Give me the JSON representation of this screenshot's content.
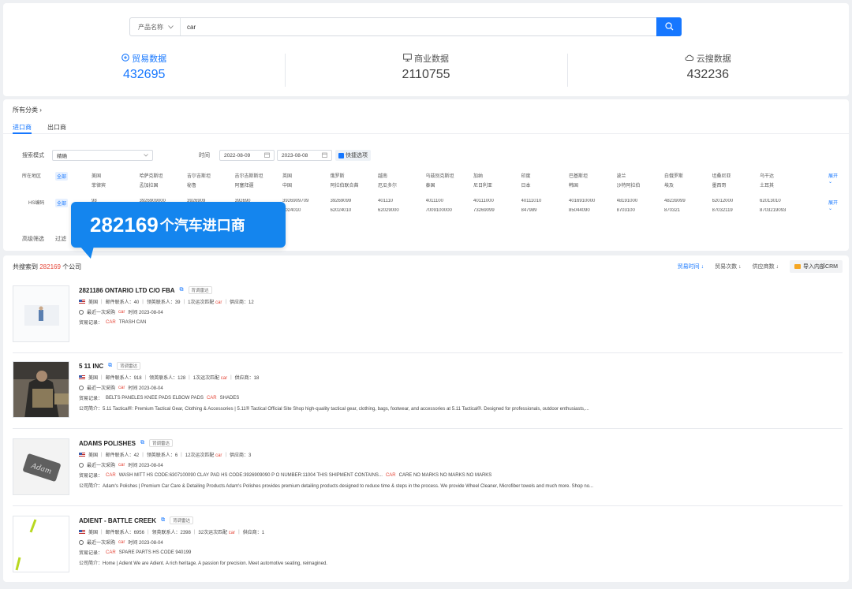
{
  "search": {
    "select_label": "产品名称",
    "value": "car"
  },
  "stats": [
    {
      "label": "贸易数据",
      "value": "432695",
      "icon": "trade-data-icon"
    },
    {
      "label": "商业数据",
      "value": "2110755",
      "icon": "business-data-icon"
    },
    {
      "label": "云搜数据",
      "value": "432236",
      "icon": "cloud-search-icon"
    }
  ],
  "filters": {
    "all_categories": "所有分类",
    "tabs": [
      "进口商",
      "出口商"
    ],
    "mode_label": "搜索模式",
    "mode_value": "精确",
    "time_label": "时间",
    "date_from": "2022-08-09",
    "date_to": "2023-08-08",
    "quick_option": "快捷选项",
    "region_label": "所在地区",
    "all": "全部",
    "expand": "展开",
    "regions_row1": [
      "美国",
      "哈萨克斯坦",
      "吉尔吉斯坦",
      "吉尔吉斯斯坦",
      "英国",
      "俄罗斯",
      "越南",
      "乌兹别克斯坦",
      "加纳",
      "印度",
      "巴基斯坦",
      "波兰",
      "白俄罗斯",
      "坦桑尼亚",
      "乌干达"
    ],
    "regions_row2": [
      "菲律宾",
      "孟加拉国",
      "秘鲁",
      "阿塞拜疆",
      "中国",
      "阿拉伯联合酋",
      "厄瓜多尔",
      "泰国",
      "尼日利亚",
      "日本",
      "韩国",
      "沙特阿拉伯",
      "埃及",
      "墨西哥",
      "土耳其"
    ],
    "hs_label": "HS编码",
    "hs_row1": [
      "98",
      "3926909000",
      "3926909",
      "392690",
      "3926909709",
      "39269099",
      "401110",
      "4011100",
      "40111000",
      "40111010",
      "4016910000",
      "48191000",
      "48239099",
      "62012000",
      "62013010"
    ],
    "hs_row2": [
      "",
      "",
      "",
      "",
      "6024010",
      "62024010",
      "62029000",
      "7009100000",
      "73269099",
      "847989",
      "85044090",
      "8703100",
      "870321",
      "87032119",
      "8703219093"
    ],
    "advanced_label": "高级筛选",
    "advanced_value": "过滤"
  },
  "tooltip": {
    "number": "282169",
    "text": "个汽车进口商"
  },
  "results": {
    "prefix": "共搜索到",
    "count": "282169",
    "suffix": "个公司",
    "sort_trade_time": "贸易时间",
    "sort_trade_count": "贸易次数",
    "sort_supplier_count": "供应商数",
    "crm_button": "导入内部CRM",
    "items": [
      {
        "name": "2821186 ONTARIO LTD C/O FBA",
        "tag": "背调雷达",
        "country": "美国",
        "mail": "邮件联系人：40",
        "linkedin": "领英联系人：39",
        "match": "1次运次匹配",
        "match_kw": "car",
        "supplier": "供应商：12",
        "last_buy_prefix": "最近一次采购",
        "last_buy_kw": "car",
        "last_buy_time": "时间 2023-08-04",
        "record_label": "贸易记录：",
        "record_kw": "CAR",
        "record_text": "TRASH CAN",
        "intro": ""
      },
      {
        "name": "5 11 INC",
        "tag": "背调雷达",
        "country": "美国",
        "mail": "邮件联系人：918",
        "linkedin": "领英联系人：128",
        "match": "1次运次匹配",
        "match_kw": "car",
        "supplier": "供应商：18",
        "last_buy_prefix": "最近一次采购",
        "last_buy_kw": "car",
        "last_buy_time": "时间 2023-08-04",
        "record_label": "贸易记录：",
        "record_kw": "CAR",
        "record_text": "BELTS PANELES KNEE PADS ELBOW PADS",
        "record_after": "SHADES",
        "intro": "公司简介：5.11 Tactical®: Premium Tactical Gear, Clothing & Accessories | 5.11® Tactical Official Site Shop high-quality tactical gear, clothing, bags, footwear, and accessories at 5.11 Tactical®. Designed for professionals, outdoor enthusiasts,..."
      },
      {
        "name": "ADAMS POLISHES",
        "tag": "背调雷达",
        "country": "美国",
        "mail": "邮件联系人：42",
        "linkedin": "领英联系人：6",
        "match": "12次运次匹配",
        "match_kw": "car",
        "supplier": "供应商：3",
        "last_buy_prefix": "最近一次采购",
        "last_buy_kw": "car",
        "last_buy_time": "时间 2023-08-04",
        "record_label": "贸易记录：",
        "record_kw": "CAR",
        "record_text": "WASH MITT HS CODE:6307100090 CLAY PAD HS CODE:3926909090 P O NUMBER:11004 THIS SHIPMENT CONTAINS...",
        "record_kw2": "CAR",
        "record_after": "CARE NO MARKS NO MARKS NO MARKS",
        "intro": "公司简介：Adam's Polishes | Premium Car Care & Detailing Products Adam's Polishes provides premium detailing products designed to reduce time & steps in the process. We provide Wheel Cleaner, Microfiber towels and much more. Shop no..."
      },
      {
        "name": "ADIENT - BATTLE CREEK",
        "tag": "背调雷达",
        "country": "美国",
        "mail": "邮件联系人：6956",
        "linkedin": "领英联系人：2398",
        "match": "32次运次匹配",
        "match_kw": "car",
        "supplier": "供应商：1",
        "last_buy_prefix": "最近一次采购",
        "last_buy_kw": "car",
        "last_buy_time": "时间 2023-08-04",
        "record_label": "贸易记录：",
        "record_kw": "CAR",
        "record_text": "SPARE PARTS HS CODE 940199",
        "intro": "公司简介：Home | Adient We are Adient. A rich heritage. A passion for precision. Meet automotive seating, reimagined."
      }
    ]
  },
  "colors": {
    "accent": "#1677ff",
    "highlight": "#e5483a",
    "tooltip": "#1485ee"
  }
}
